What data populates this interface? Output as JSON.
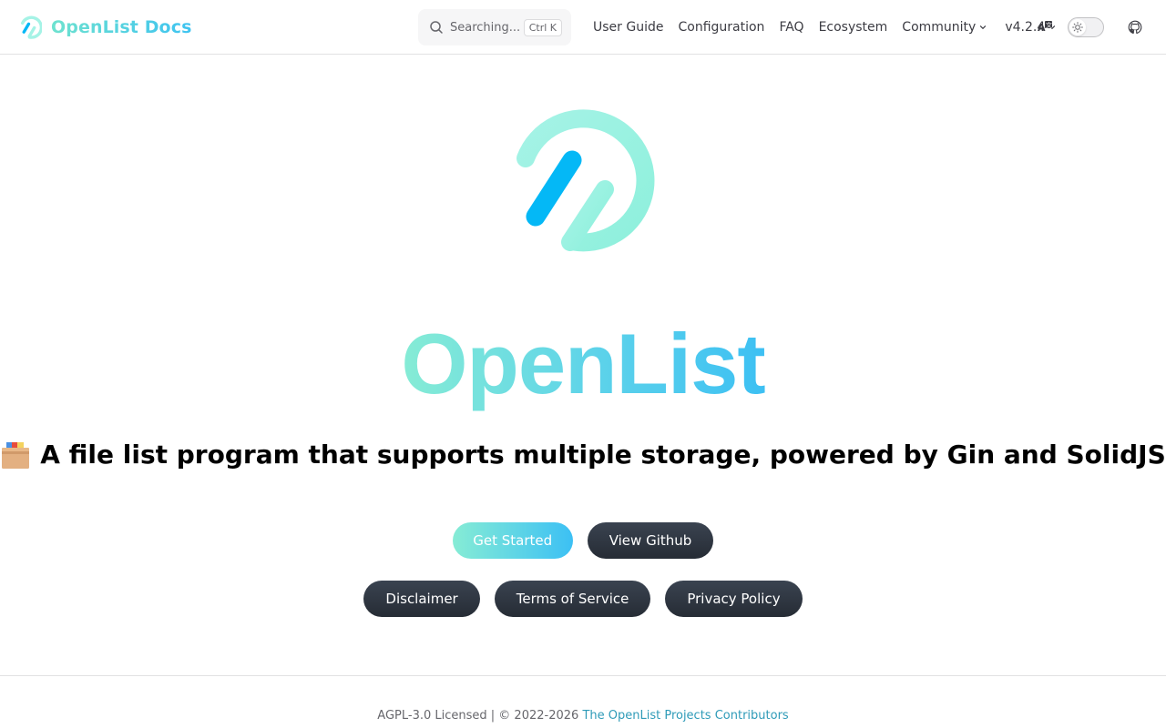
{
  "colors": {
    "brand_start": "#86ecd5",
    "brand_end": "#3cc0f4",
    "logo_stroke": "#a5f3e6",
    "logo_bar": "#04b8f6",
    "dark_button": "#262c35",
    "footer_link": "#2f9bb8"
  },
  "header": {
    "site_title": "OpenList Docs",
    "logo_icon": "openlist-logo",
    "search": {
      "placeholder": "Searching...",
      "shortcut": "Ctrl K",
      "icon": "search-icon"
    },
    "nav": [
      {
        "label": "User Guide"
      },
      {
        "label": "Configuration"
      },
      {
        "label": "FAQ"
      },
      {
        "label": "Ecosystem"
      },
      {
        "label": "Community",
        "has_dropdown": true
      }
    ],
    "version": {
      "label": "v4.2.4",
      "has_dropdown": true
    },
    "translate_icon": "translate-icon",
    "theme_toggle": {
      "icon": "sun-icon",
      "dark_mode": false
    },
    "github_icon": "github-icon"
  },
  "hero": {
    "name": "OpenList",
    "tagline_icon": "card-file-box-emoji",
    "tagline": "A file list program that supports multiple storage, powered by Gin and SolidJS",
    "actions": [
      {
        "label": "Get Started",
        "theme": "brand"
      },
      {
        "label": "View Github",
        "theme": "alt"
      },
      {
        "label": "Disclaimer",
        "theme": "alt"
      },
      {
        "label": "Terms of Service",
        "theme": "alt"
      },
      {
        "label": "Privacy Policy",
        "theme": "alt"
      }
    ]
  },
  "footer": {
    "copyright_text": "AGPL-3.0 Licensed | © 2022-2026",
    "contributors_link": "The OpenList Projects Contributors"
  }
}
